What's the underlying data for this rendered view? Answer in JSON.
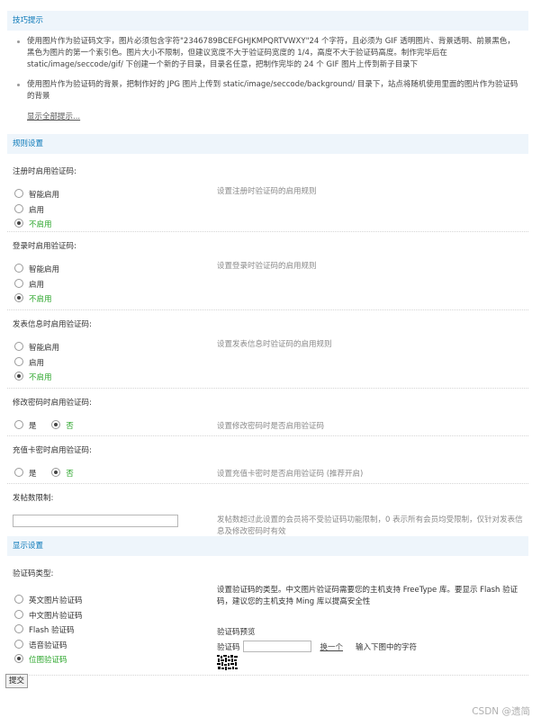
{
  "tips_section": {
    "title": "技巧提示",
    "items": [
      "使用图片作为验证码文字，图片必须包含字符\"2346789BCEFGHJKMPQRTVWXY\"24 个字符，且必须为 GIF 透明图片、背景透明、前景黑色，黑色为图片的第一个索引色。图片大小不限制，但建议宽度不大于验证码宽度的 1/4，高度不大于验证码高度。制作完毕后在 static/image/seccode/gif/ 下创建一个新的子目录，目录名任意，把制作完毕的 24 个 GIF 图片上传到新子目录下",
      "使用图片作为验证码的背景，把制作好的 JPG 图片上传到 static/image/seccode/background/ 目录下，站点将随机使用里面的图片作为验证码的背景"
    ],
    "show_all": "显示全部提示..."
  },
  "rules_section": {
    "title": "规则设置",
    "register": {
      "title": "注册时启用验证码:",
      "options": [
        "智能启用",
        "启用",
        "不启用"
      ],
      "desc": "设置注册时验证码的启用规则"
    },
    "login": {
      "title": "登录时启用验证码:",
      "options": [
        "智能启用",
        "启用",
        "不启用"
      ],
      "desc": "设置登录时验证码的启用规则"
    },
    "post": {
      "title": "发表信息时启用验证码:",
      "options": [
        "智能启用",
        "启用",
        "不启用"
      ],
      "desc": "设置发表信息时验证码的启用规则"
    },
    "password": {
      "title": "修改密码时启用验证码:",
      "options": [
        "是",
        "否"
      ],
      "desc": "设置修改密码时是否启用验证码"
    },
    "recharge": {
      "title": "充值卡密时启用验证码:",
      "options": [
        "是",
        "否"
      ],
      "desc": "设置充值卡密时是否启用验证码 (推荐开启)"
    },
    "post_limit": {
      "title": "发帖数限制:",
      "value": "",
      "desc": "发帖数超过此设置的会员将不受验证码功能限制，0 表示所有会员均受限制，仅针对发表信息及修改密码时有效"
    }
  },
  "display_section": {
    "title": "显示设置",
    "type": {
      "title": "验证码类型:",
      "options": [
        "英文图片验证码",
        "中文图片验证码",
        "Flash 验证码",
        "语音验证码",
        "位图验证码"
      ],
      "desc": "设置验证码的类型。中文图片验证码需要您的主机支持 FreeType 库。要显示 Flash 验证码，建议您的主机支持 Ming 库以提高安全性"
    },
    "preview": {
      "title": "验证码预览",
      "label": "验证码",
      "input_value": "",
      "switch_link": "换一个",
      "hint": "输入下图中的字符"
    }
  },
  "submit_label": "提交",
  "watermark": "CSDN @遗简",
  "colors": {
    "section_bg": "#eef5fb",
    "section_title": "#0a78b8",
    "selected_label": "#2aa52a",
    "desc": "#8a8a8a"
  }
}
